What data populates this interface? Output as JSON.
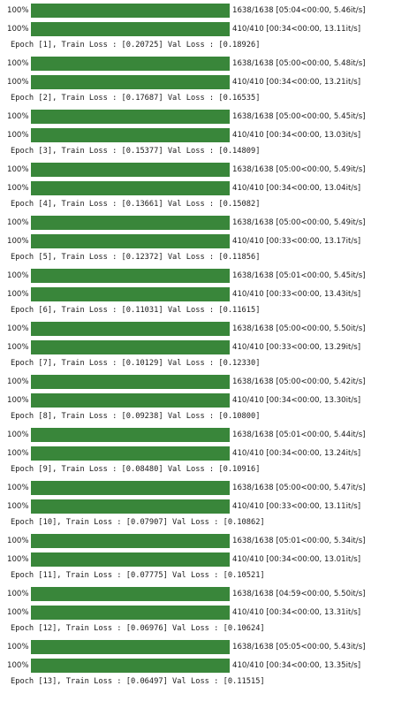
{
  "progress_percent_label": "100%",
  "progress_fill_fraction": 1.0,
  "colors": {
    "bar_fill": "#39863a",
    "bar_track": "#e8e8e8",
    "text": "#1a1a1a",
    "background": "#ffffff"
  },
  "epochs": [
    {
      "train_stats": "1638/1638 [05:04<00:00, 5.46it/s]",
      "val_stats": "410/410 [00:34<00:00, 13.11it/s]",
      "summary": "Epoch [1], Train Loss : [0.20725] Val Loss : [0.18926]"
    },
    {
      "train_stats": "1638/1638 [05:00<00:00, 5.48it/s]",
      "val_stats": "410/410 [00:34<00:00, 13.21it/s]",
      "summary": "Epoch [2], Train Loss : [0.17687] Val Loss : [0.16535]"
    },
    {
      "train_stats": "1638/1638 [05:00<00:00, 5.45it/s]",
      "val_stats": "410/410 [00:34<00:00, 13.03it/s]",
      "summary": "Epoch [3], Train Loss : [0.15377] Val Loss : [0.14809]"
    },
    {
      "train_stats": "1638/1638 [05:00<00:00, 5.49it/s]",
      "val_stats": "410/410 [00:34<00:00, 13.04it/s]",
      "summary": "Epoch [4], Train Loss : [0.13661] Val Loss : [0.15082]"
    },
    {
      "train_stats": "1638/1638 [05:00<00:00, 5.49it/s]",
      "val_stats": "410/410 [00:33<00:00, 13.17it/s]",
      "summary": "Epoch [5], Train Loss : [0.12372] Val Loss : [0.11856]"
    },
    {
      "train_stats": "1638/1638 [05:01<00:00, 5.45it/s]",
      "val_stats": "410/410 [00:33<00:00, 13.43it/s]",
      "summary": "Epoch [6], Train Loss : [0.11031] Val Loss : [0.11615]"
    },
    {
      "train_stats": "1638/1638 [05:00<00:00, 5.50it/s]",
      "val_stats": "410/410 [00:33<00:00, 13.29it/s]",
      "summary": "Epoch [7], Train Loss : [0.10129] Val Loss : [0.12330]"
    },
    {
      "train_stats": "1638/1638 [05:00<00:00, 5.42it/s]",
      "val_stats": "410/410 [00:34<00:00, 13.30it/s]",
      "summary": "Epoch [8], Train Loss : [0.09238] Val Loss : [0.10800]"
    },
    {
      "train_stats": "1638/1638 [05:01<00:00, 5.44it/s]",
      "val_stats": "410/410 [00:34<00:00, 13.24it/s]",
      "summary": "Epoch [9], Train Loss : [0.08480] Val Loss : [0.10916]"
    },
    {
      "train_stats": "1638/1638 [05:00<00:00, 5.47it/s]",
      "val_stats": "410/410 [00:33<00:00, 13.11it/s]",
      "summary": "Epoch [10], Train Loss : [0.07907] Val Loss : [0.10862]"
    },
    {
      "train_stats": "1638/1638 [05:01<00:00, 5.34it/s]",
      "val_stats": "410/410 [00:34<00:00, 13.01it/s]",
      "summary": "Epoch [11], Train Loss : [0.07775] Val Loss : [0.10521]"
    },
    {
      "train_stats": "1638/1638 [04:59<00:00, 5.50it/s]",
      "val_stats": "410/410 [00:34<00:00, 13.31it/s]",
      "summary": "Epoch [12], Train Loss : [0.06976] Val Loss : [0.10624]"
    },
    {
      "train_stats": "1638/1638 [05:05<00:00, 5.43it/s]",
      "val_stats": "410/410 [00:34<00:00, 13.35it/s]",
      "summary": "Epoch [13], Train Loss : [0.06497] Val Loss : [0.11515]"
    }
  ]
}
